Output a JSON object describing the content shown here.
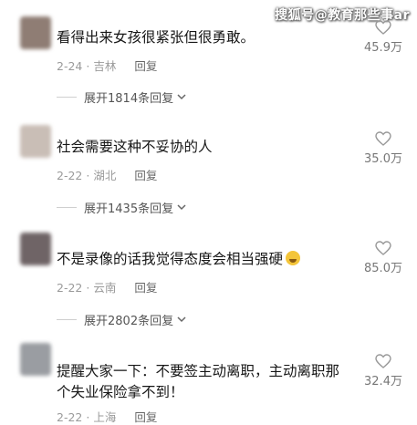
{
  "watermark": "搜狐号@教育那些事ar",
  "comments": [
    {
      "text": "看得出来女孩很紧张但很勇敢。",
      "date": "2-24",
      "location": "吉林",
      "reply_label": "回复",
      "likes": "45.9万",
      "expand": "展开1814条回复",
      "avatar_color": "#8f7d74"
    },
    {
      "text": "社会需要这种不妥协的人",
      "date": "2-22",
      "location": "湖北",
      "reply_label": "回复",
      "likes": "35.0万",
      "expand": "展开1435条回复",
      "avatar_color": "#c9beb6"
    },
    {
      "text": "不是录像的话我觉得态度会相当强硬",
      "emoji": "laughing-emoji",
      "date": "2-22",
      "location": "云南",
      "reply_label": "回复",
      "likes": "85.0万",
      "expand": "展开2802条回复",
      "avatar_color": "#6f6466"
    },
    {
      "text": "提醒大家一下：不要签主动离职，主动离职那个失业保险拿不到！",
      "date": "2-22",
      "location": "上海",
      "reply_label": "回复",
      "likes": "32.4万",
      "avatar_color": "#9a9da2"
    }
  ]
}
